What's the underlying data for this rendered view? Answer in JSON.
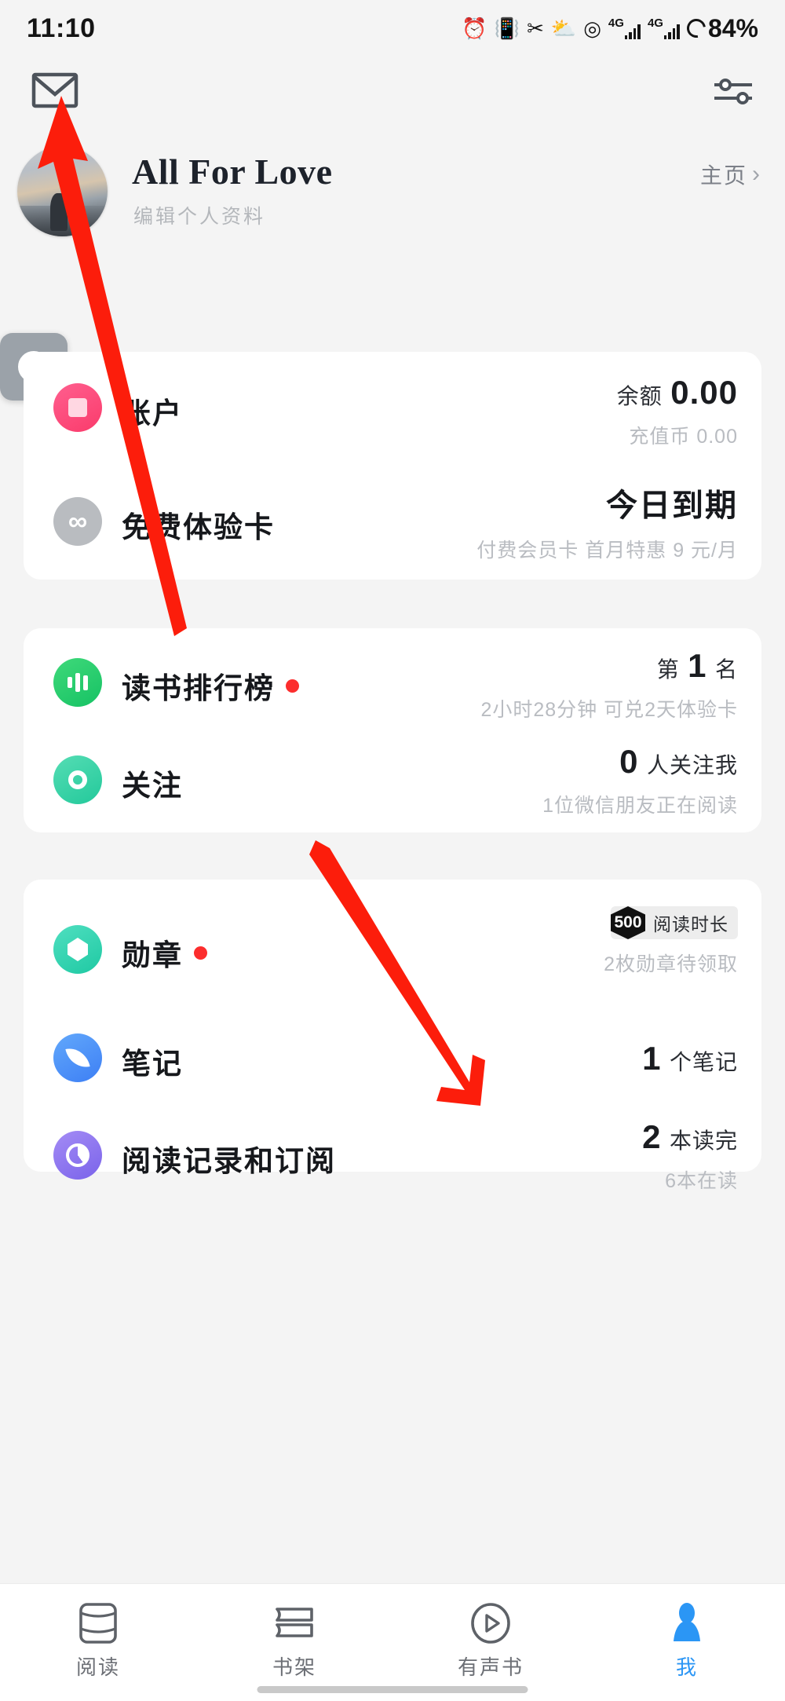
{
  "status": {
    "time": "11:10",
    "battery": "84%",
    "icons": [
      "alarm-icon",
      "vibrate-icon",
      "scissors-icon",
      "weather-icon",
      "location-icon",
      "signal-4g-1",
      "signal-4g-2",
      "battery-ring"
    ],
    "network_label": "4G"
  },
  "topbar": {
    "mail_icon": "mail-envelope-icon",
    "filter_icon": "sliders-settings-icon"
  },
  "profile": {
    "name": "All For Love",
    "edit_label": "编辑个人资料",
    "home_label": "主页",
    "chevron": "›",
    "avatar_icon": "user-avatar-photo"
  },
  "theme_toggle": {
    "icon": "contrast-half-circle-icon"
  },
  "cards": [
    {
      "name": "account-card",
      "rows": [
        {
          "id": "account",
          "label": "账户",
          "icon": "wallet-card-icon",
          "badge": false,
          "right_prefix": "余额",
          "right_value": "0.00",
          "sub_prefix": "充值币",
          "sub_value": "0.00"
        },
        {
          "id": "free-trial",
          "label": "免费体验卡",
          "icon": "infinity-icon",
          "badge": false,
          "right_value": "今日到期",
          "sub": "付费会员卡 首月特惠 9 元/月"
        }
      ]
    },
    {
      "name": "reading-card",
      "rows": [
        {
          "id": "reading-rank",
          "label": "读书排行榜",
          "icon": "bar-chart-icon",
          "badge": true,
          "right_prefix": "第",
          "right_value": "1",
          "right_suffix": "名",
          "sub": "2小时28分钟 可兑2天体验卡"
        },
        {
          "id": "follow",
          "label": "关注",
          "icon": "eye-circle-icon",
          "badge": false,
          "right_value": "0",
          "right_suffix": "人关注我",
          "sub": "1位微信朋友正在阅读"
        }
      ]
    },
    {
      "name": "activity-card",
      "rows": [
        {
          "id": "medals",
          "label": "勋章",
          "icon": "medal-hex-icon",
          "badge": true,
          "medal_badge_num": "500",
          "medal_badge_text": "阅读时长",
          "sub": "2枚勋章待领取"
        },
        {
          "id": "notes",
          "label": "笔记",
          "icon": "feather-pen-icon",
          "badge": false,
          "right_value": "1",
          "right_suffix": "个笔记"
        },
        {
          "id": "history",
          "label": "阅读记录和订阅",
          "icon": "clock-progress-icon",
          "badge": false,
          "right_value": "2",
          "right_suffix": "本读完",
          "sub": "6本在读"
        }
      ]
    }
  ],
  "bottom_nav": {
    "items": [
      {
        "label": "阅读",
        "icon": "book-open-icon",
        "active": false
      },
      {
        "label": "书架",
        "icon": "bookshelf-icon",
        "active": false
      },
      {
        "label": "有声书",
        "icon": "play-circle-icon",
        "active": false
      },
      {
        "label": "我",
        "icon": "person-icon",
        "active": true
      }
    ],
    "active_color": "#2b96f5"
  },
  "annotations": {
    "arrow_color": "#fc1d0b",
    "arrow_1": "points-to-mail-icon",
    "arrow_2": "points-to-me-tab"
  }
}
